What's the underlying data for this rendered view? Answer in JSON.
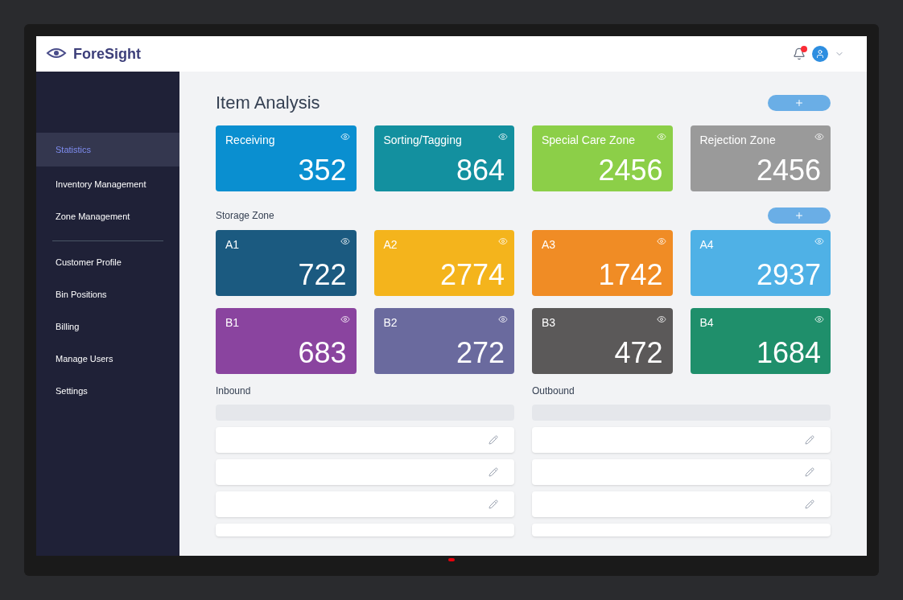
{
  "header": {
    "logo": "ForeSight"
  },
  "sidebar": {
    "items": [
      {
        "label": "Statistics",
        "selected": true
      },
      {
        "label": "Inventory Management",
        "selected": false
      },
      {
        "label": "Zone Management",
        "selected": false
      },
      {
        "label": "Customer Profile",
        "selected": false
      },
      {
        "label": "Bin Positions",
        "selected": false
      },
      {
        "label": "Billing",
        "selected": false
      },
      {
        "label": "Manage Users",
        "selected": false
      },
      {
        "label": "Settings",
        "selected": false
      }
    ]
  },
  "item_analysis": {
    "title": "Item Analysis",
    "cards": [
      {
        "title": "Receiving",
        "value": "352",
        "color": "#0a8fd0"
      },
      {
        "title": "Sorting/Tagging",
        "value": "864",
        "color": "#13909f"
      },
      {
        "title": "Special Care Zone",
        "value": "2456",
        "color": "#8ccf48"
      },
      {
        "title": "Rejection Zone",
        "value": "2456",
        "color": "#9a9a9a"
      }
    ]
  },
  "storage_zone": {
    "title": "Storage Zone",
    "cards": [
      {
        "title": "A1",
        "value": "722",
        "color": "#1b5a80"
      },
      {
        "title": "A2",
        "value": "2774",
        "color": "#f4b41c"
      },
      {
        "title": "A3",
        "value": "1742",
        "color": "#f08c25"
      },
      {
        "title": "A4",
        "value": "2937",
        "color": "#4fb1e6"
      },
      {
        "title": "B1",
        "value": "683",
        "color": "#8a449f"
      },
      {
        "title": "B2",
        "value": "272",
        "color": "#6a6a9e"
      },
      {
        "title": "B3",
        "value": "472",
        "color": "#5b5959"
      },
      {
        "title": "B4",
        "value": "1684",
        "color": "#1f8f6b"
      }
    ]
  },
  "tables": [
    {
      "title": "Inbound"
    },
    {
      "title": "Outbound"
    }
  ]
}
